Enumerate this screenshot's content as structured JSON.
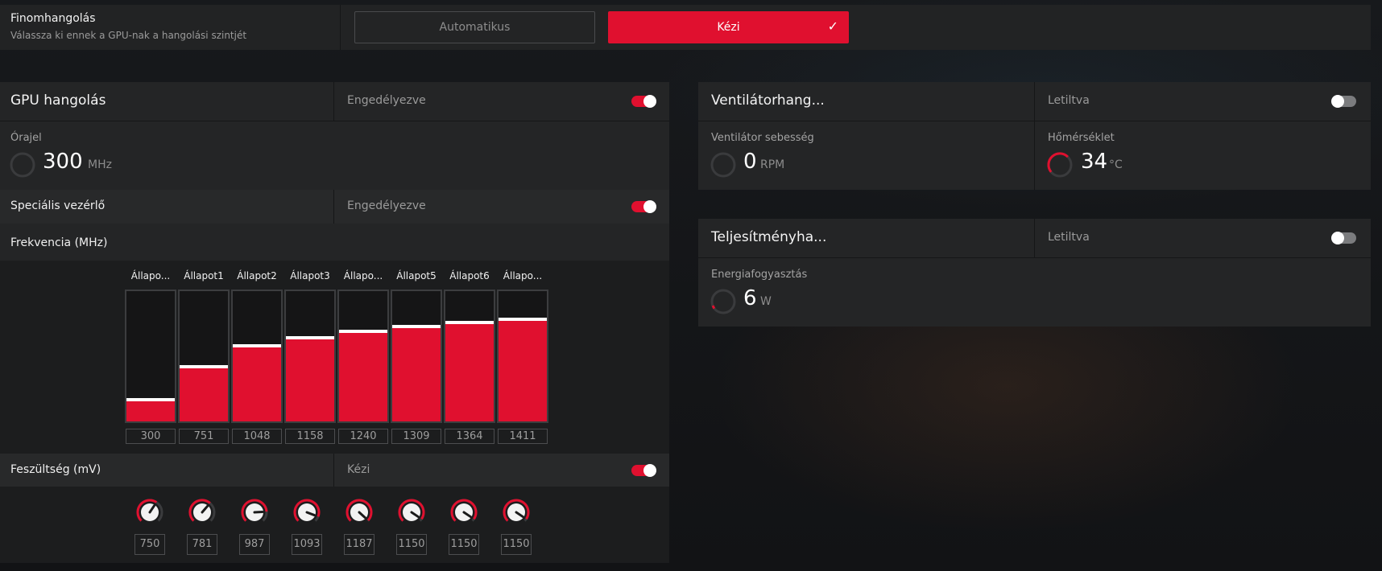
{
  "top": {
    "title": "Finomhangolás",
    "subtitle": "Válassza ki ennek a GPU-nak a hangolási szintjét",
    "auto_label": "Automatikus",
    "manual_label": "Kézi",
    "selected": "manual"
  },
  "gpu": {
    "title": "GPU hangolás",
    "status": "Engedélyezve",
    "enabled": true,
    "clock_label": "Órajel",
    "clock_value": "300",
    "clock_unit": "MHz",
    "advanced_label": "Speciális vezérlő",
    "advanced_status": "Engedélyezve",
    "advanced_enabled": true,
    "freq_title": "Frekvencia (MHz)",
    "freq_max": 1800,
    "states": [
      {
        "label": "Állapo...",
        "freq": 300,
        "freq_text": "300"
      },
      {
        "label": "Állapot1",
        "freq": 751,
        "freq_text": "751"
      },
      {
        "label": "Állapot2",
        "freq": 1048,
        "freq_text": "1048"
      },
      {
        "label": "Állapot3",
        "freq": 1158,
        "freq_text": "1158"
      },
      {
        "label": "Állapo...",
        "freq": 1240,
        "freq_text": "1240"
      },
      {
        "label": "Állapot5",
        "freq": 1309,
        "freq_text": "1309"
      },
      {
        "label": "Állapot6",
        "freq": 1364,
        "freq_text": "1364"
      },
      {
        "label": "Állapo...",
        "freq": 1411,
        "freq_text": "1411"
      }
    ],
    "volt_title": "Feszültség (mV)",
    "volt_status": "Kézi",
    "volt_enabled": true,
    "volt_max": 1200,
    "voltages": [
      {
        "mv": 750,
        "text": "750"
      },
      {
        "mv": 781,
        "text": "781"
      },
      {
        "mv": 987,
        "text": "987"
      },
      {
        "mv": 1093,
        "text": "1093"
      },
      {
        "mv": 1187,
        "text": "1187"
      },
      {
        "mv": 1150,
        "text": "1150"
      },
      {
        "mv": 1150,
        "text": "1150"
      },
      {
        "mv": 1150,
        "text": "1150"
      }
    ]
  },
  "fan": {
    "title": "Ventilátorhang...",
    "status": "Letiltva",
    "enabled": false,
    "speed_label": "Ventilátor sebesség",
    "speed_value": "0",
    "speed_unit": "RPM",
    "temp_label": "Hőmérséklet",
    "temp_value": "34",
    "temp_unit": "°C"
  },
  "perf": {
    "title": "Teljesítményha...",
    "status": "Letiltva",
    "enabled": false,
    "power_label": "Energiafogyasztás",
    "power_value": "6",
    "power_unit": "W"
  },
  "colors": {
    "accent": "#e0102f",
    "panel": "#242526",
    "track": "#3a3b3d"
  },
  "icons": {
    "check": "checkmark-icon",
    "gauge": "gauge-ring-icon",
    "knob": "voltage-dial-icon"
  }
}
